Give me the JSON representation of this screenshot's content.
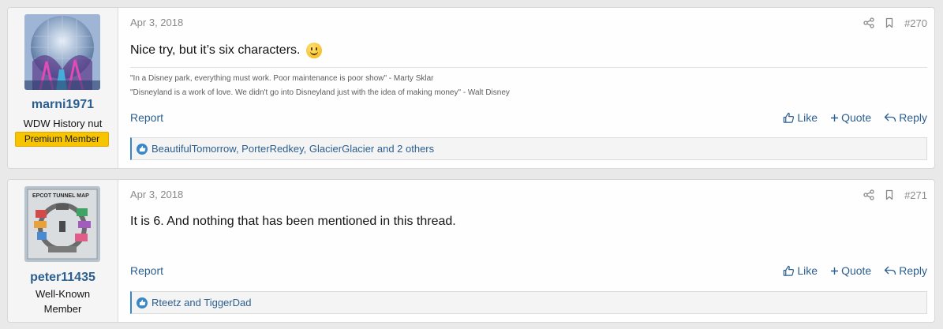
{
  "posts": [
    {
      "user": {
        "name": "marni1971",
        "title": "WDW History nut",
        "banner": "Premium Member"
      },
      "date": "Apr 3, 2018",
      "number": "#270",
      "message": "Nice try, but it’s six characters.",
      "smilie": "smile-emoji",
      "signature": [
        "\"In a Disney park, everything must work. Poor maintenance is poor show\" - Marty Sklar",
        "\"Disneyland is a work of love. We didn't go into Disneyland just with the idea of making money\" - Walt Disney"
      ],
      "actions": {
        "report": "Report",
        "like": "Like",
        "quote": "Quote",
        "reply": "Reply"
      },
      "reactions": "BeautifulTomorrow, PorterRedkey, GlacierGlacier and 2 others"
    },
    {
      "user": {
        "name": "peter11435",
        "title_line1": "Well-Known",
        "title_line2": "Member"
      },
      "date": "Apr 3, 2018",
      "number": "#271",
      "message": "It is 6. And nothing that has been mentioned in this thread.",
      "actions": {
        "report": "Report",
        "like": "Like",
        "quote": "Quote",
        "reply": "Reply"
      },
      "reactions": "Rteetz and TiggerDad",
      "avatar_caption": "EPCOT TUNNEL MAP"
    }
  ],
  "icons": {
    "share": "share-icon",
    "bookmark": "bookmark-icon",
    "like": "thumbs-up-icon",
    "quote": "plus-icon",
    "reply": "reply-arrow-icon"
  },
  "colors": {
    "link": "#2b5f8f",
    "banner": "#f7c400",
    "reaction_accent": "#3a87c7",
    "meta_text": "#8a8a8a"
  }
}
